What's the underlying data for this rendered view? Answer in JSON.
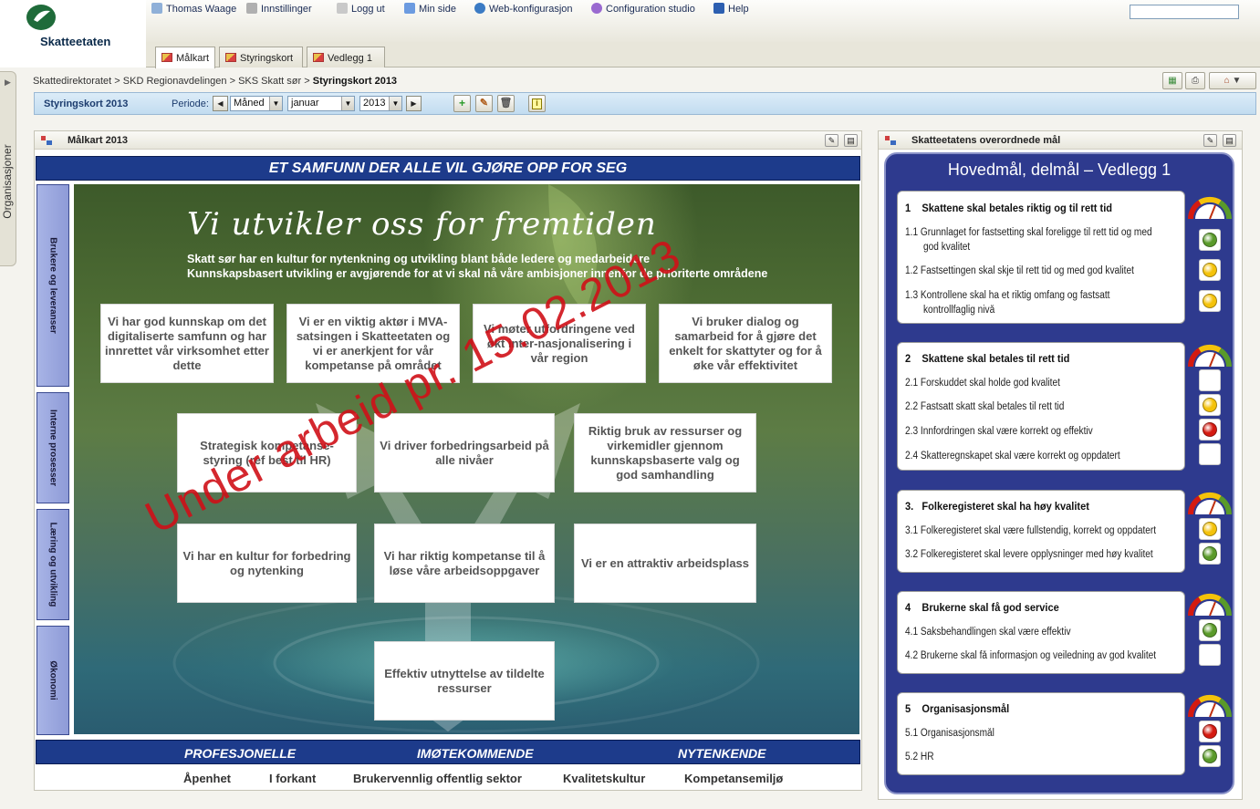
{
  "app": {
    "name": "Skatteetaten"
  },
  "topnav": {
    "items": [
      {
        "label": "Thomas Waage",
        "icon": "user-icon"
      },
      {
        "label": "Innstillinger",
        "icon": "wrench-icon"
      },
      {
        "label": "Logg ut",
        "icon": "logout-icon"
      },
      {
        "label": "Min side",
        "icon": "page-icon"
      },
      {
        "label": "Web-konfigurasjon",
        "icon": "globe-icon"
      },
      {
        "label": "Configuration studio",
        "icon": "studio-icon"
      },
      {
        "label": "Help",
        "icon": "help-icon"
      }
    ],
    "search_value": ""
  },
  "tabs": [
    {
      "label": "Målkart",
      "active": true
    },
    {
      "label": "Styringskort",
      "active": false
    },
    {
      "label": "Vedlegg 1",
      "active": false
    }
  ],
  "sidebar": {
    "label": "Organisasjoner"
  },
  "breadcrumb": {
    "items": [
      "Skattedirektoratet",
      "SKD Regionavdelingen",
      "SKS Skatt sør"
    ],
    "current": "Styringskort 2013",
    "separator": ">"
  },
  "toolbar": {
    "title": "Styringskort 2013",
    "period_label": "Periode:",
    "period_type": "Måned",
    "month": "januar",
    "year": "2013"
  },
  "left_panel": {
    "title": "Målkart 2013",
    "banner": "ET SAMFUNN DER ALLE VIL GJØRE OPP FOR SEG",
    "perspectives": [
      "Brukere og leveranser",
      "Interne prosesser",
      "Læring og utvikling",
      "Økonomi"
    ],
    "heading": "Vi utvikler oss for fremtiden",
    "subtitle_1": "Skatt sør har en kultur for nytenkning og utvikling blant både ledere og medarbeidere",
    "subtitle_2": "Kunnskapsbasert  utvikling er avgjørende for at vi skal nå våre ambisjoner innenfor de prioriterte områdene",
    "goals": [
      "Vi har god kunnskap om det digitaliserte samfunn og har innrettet vår virksomhet etter dette",
      "Vi er en viktig aktør i MVA-satsingen  i Skatteetaten og vi er anerkjent for vår kompetanse på området",
      "Vi møter utfordringene ved  økt inter-nasjonalisering i vår region",
      "Vi bruker dialog og samarbeid for å gjøre det enkelt for skattyter  og for å øke vår effektivitet",
      "Strategisk kompetanse-styring  (ref best til HR)",
      "Vi driver forbedringsarbeid på alle nivåer",
      "Riktig  bruk av ressurser  og virkemidler gjennom kunnskapsbaserte  valg og god samhandling",
      "Vi har en kultur for forbedring og nytenking",
      "Vi har riktig kompetanse til å løse våre arbeidsoppgaver",
      "Vi er en attraktiv arbeidsplass",
      "Effektiv  utnyttelse av tildelte ressurser"
    ],
    "stamp": "Under arbeid pr. 15.02.2013",
    "bottom_banner": [
      "PROFESJONELLE",
      "IMØTEKOMMENDE",
      "NYTENKENDE"
    ],
    "values": [
      "Åpenhet",
      "I forkant",
      "Brukervennlig offentlig sektor",
      "Kvalitetskultur",
      "Kompetansemiljø"
    ]
  },
  "right_panel": {
    "title": "Skatteetatens overordnede mål",
    "heading": "Hovedmål, delmål – Vedlegg 1",
    "groups": [
      {
        "number": "1",
        "title": "Skattene skal betales riktig og til rett tid",
        "items": [
          {
            "num": "1.1",
            "text": "Grunnlaget for fastsetting  skal foreligge til rett tid og med",
            "text2": "god kvalitet",
            "status": "green"
          },
          {
            "num": "1.2",
            "text": "Fastsettingen  skal skje til rett tid og med god kvalitet",
            "status": "yellow"
          },
          {
            "num": "1.3",
            "text": "Kontrollene  skal ha et riktig  omfang  og fastsatt",
            "text2": "kontrollfaglig  nivå",
            "status": "yellow"
          }
        ]
      },
      {
        "number": "2",
        "title": "Skattene skal betales til rett tid",
        "items": [
          {
            "num": "2.1",
            "text": "Forskuddet skal  holde god kvalitet",
            "status": "none"
          },
          {
            "num": "2.2",
            "text": "Fastsatt  skatt  skal betales  til rett  tid",
            "status": "yellow"
          },
          {
            "num": "2.3",
            "text": "Innfordringen  skal være korrekt og effektiv",
            "status": "red"
          },
          {
            "num": "2.4",
            "text": "Skatteregnskapet  skal  være korrekt og oppdatert",
            "status": "none"
          }
        ]
      },
      {
        "number": "3.",
        "title": "Folkeregisteret skal ha høy kvalitet",
        "items": [
          {
            "num": "3.1",
            "text": "Folkeregisteret  skal  være fullstendig,  korrekt  og oppdatert",
            "status": "yellow"
          },
          {
            "num": "3.2",
            "text": "Folkeregisteret  skal  levere  opplysninger  med høy kvalitet",
            "status": "green"
          }
        ]
      },
      {
        "number": "4",
        "title": "Brukerne skal få god service",
        "items": [
          {
            "num": "4.1",
            "text": "Saksbehandlingen  skal  være effektiv",
            "status": "green"
          },
          {
            "num": "4.2",
            "text": "Brukerne skal  få  informasjon  og veiledning  av god kvalitet",
            "status": "none"
          }
        ]
      },
      {
        "number": "5",
        "title": "Organisasjonsmål",
        "items": [
          {
            "num": "5.1",
            "text": "Organisasjonsmål",
            "status": "red"
          },
          {
            "num": "5.2",
            "text": "HR",
            "status": "green"
          }
        ]
      }
    ]
  },
  "colors": {
    "banner": "#1d3b8b",
    "panel_frame": "#2e3a8e",
    "green": "#5a9a2a",
    "yellow": "#f4c20a",
    "red": "#d41a10",
    "stamp": "#d01018"
  }
}
